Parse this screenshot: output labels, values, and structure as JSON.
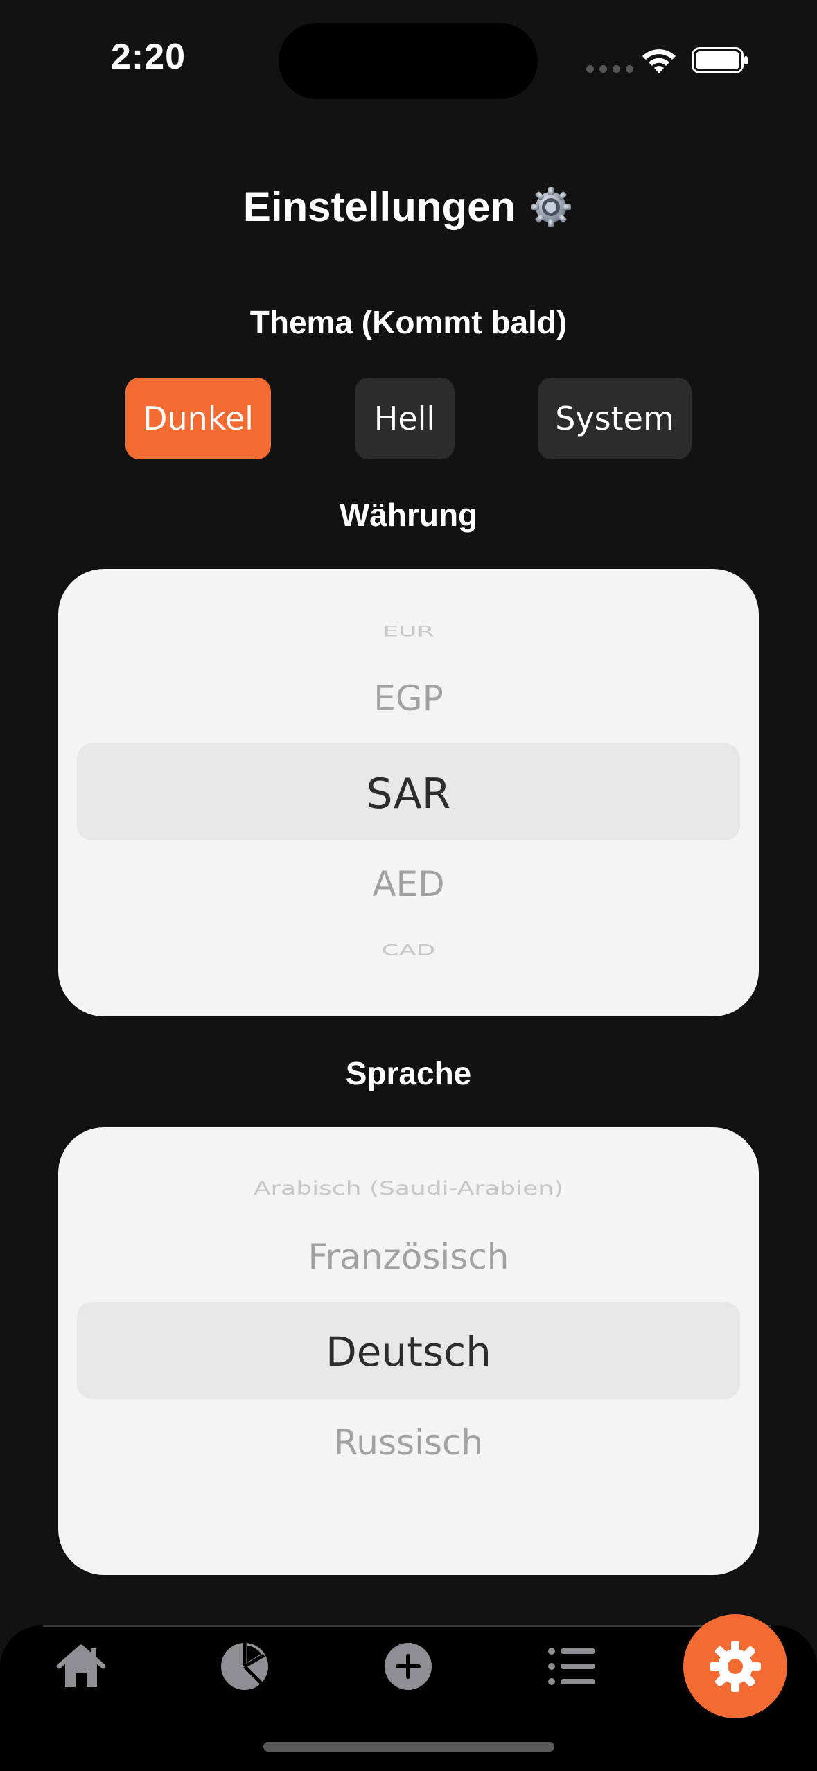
{
  "status_bar": {
    "time": "2:20"
  },
  "page": {
    "title": "Einstellungen"
  },
  "theme": {
    "label": "Thema (Kommt bald)",
    "options": [
      "Dunkel",
      "Hell",
      "System"
    ],
    "selected": "Dunkel",
    "accent_color": "#f26b32"
  },
  "currency": {
    "label": "Währung",
    "visible_options": [
      "EUR",
      "EGP",
      "SAR",
      "AED",
      "CAD"
    ],
    "selected": "SAR"
  },
  "language": {
    "label": "Sprache",
    "visible_options": [
      "Arabisch (Saudi-Arabien)",
      "Französisch",
      "Deutsch",
      "Russisch"
    ],
    "selected": "Deutsch"
  },
  "tab_bar": {
    "tabs": [
      {
        "icon": "house-icon"
      },
      {
        "icon": "pie-chart-icon"
      },
      {
        "icon": "plus-circle-icon"
      },
      {
        "icon": "list-icon"
      },
      {
        "icon": "gear-icon"
      }
    ],
    "active": "gear-icon"
  }
}
